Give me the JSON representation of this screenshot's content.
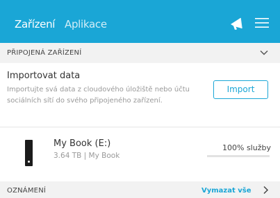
{
  "header": {
    "tabs": [
      {
        "label": "Zařízení",
        "active": true
      },
      {
        "label": "Aplikace",
        "active": false
      }
    ],
    "notification_icon": "megaphone-icon",
    "menu_icon": "hamburger-icon"
  },
  "connected_devices": {
    "heading": "PŘIPOJENÁ ZAŘÍZENÍ",
    "toggle_icon": "chevron-down-icon"
  },
  "import": {
    "title": "Importovat data",
    "description": "Importujte svá data z cloudového úložiště nebo účtu sociálních sítí do svého připojeného zařízení.",
    "button_label": "Import"
  },
  "device": {
    "name": "My Book (E:)",
    "meta": "3.64 TB | My Book",
    "status": "100% služby",
    "icon": "hard-drive-icon"
  },
  "notifications": {
    "heading": "OZNÁMENÍ",
    "clear_label": "Vymazat vše",
    "expand_icon": "chevron-right-icon"
  },
  "colors": {
    "accent": "#1aa6d6",
    "section_bg": "#f2f2f2",
    "muted_text": "#999999"
  }
}
